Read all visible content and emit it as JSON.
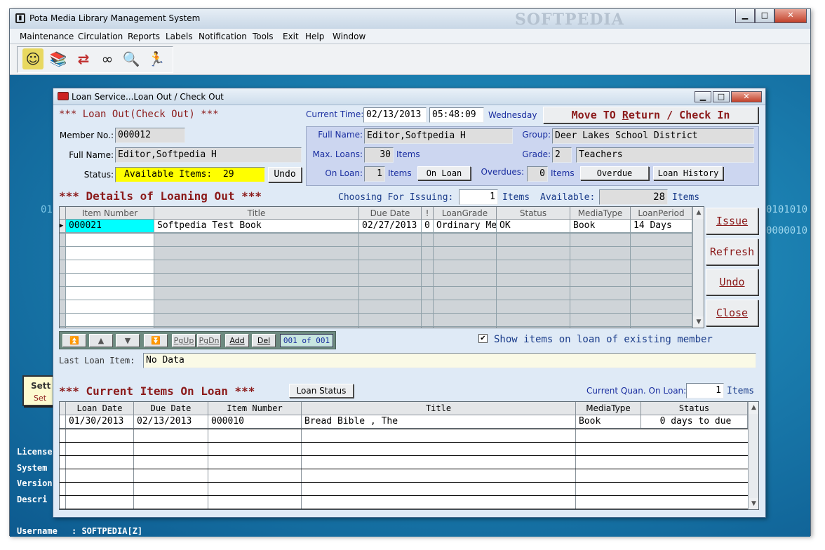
{
  "app": {
    "title": "Pota Media Library Management System",
    "watermark": "SOFTPEDIA",
    "menu": [
      "Maintenance",
      "Circulation",
      "Reports",
      "Labels",
      "Notification",
      "Tools",
      "Exit",
      "Help",
      "Window"
    ],
    "window_controls": {
      "minimize": "▁",
      "maximize": "□",
      "close": "✕"
    }
  },
  "toolbar": {
    "icons": [
      "member-icon",
      "books-icon",
      "circulation-icon",
      "glasses-icon",
      "search-icon",
      "runner-icon"
    ],
    "glyphs": [
      "☺",
      "📚",
      "⇄",
      "∞",
      "🔍",
      "🏃"
    ]
  },
  "desktop": {
    "side_button_top": "Sett",
    "side_button_bottom": "Set",
    "side_labels": [
      "License",
      "System",
      "Version",
      "Descri"
    ],
    "username_label": "Username",
    "username_value": ": SOFTPEDIA[Z]",
    "binary_left": "01",
    "binary_right_1": "0101010",
    "binary_right_2": "0000010"
  },
  "dialog": {
    "title": "Loan Service...Loan Out / Check Out",
    "controls": {
      "minimize": "▁",
      "maximize": "□",
      "close": "✕"
    },
    "header": {
      "heading": "*** Loan Out(Check Out) ***",
      "current_time_label": "Current Time:",
      "date": "02/13/2013",
      "time": "05:48:09",
      "weekday": "Wednesday",
      "mode_button_1": "Move TO ",
      "mode_button_2": "R",
      "mode_button_3": "eturn / Check In"
    },
    "member": {
      "member_no_label": "Member No.:",
      "member_no": "000012",
      "full_name_label": "Full Name:",
      "full_name": "Editor,Softpedia H",
      "status_label": "Status:",
      "status_value": "Available Items:  29",
      "undo_label": "Undo",
      "panel_full_name_label": "Full Name:",
      "panel_full_name": "Editor,Softpedia H",
      "group_label": "Group:",
      "group": "Deer Lakes School District",
      "max_loans_label": "Max. Loans:",
      "max_loans": "30",
      "items_1": "Items",
      "grade_label": "Grade:",
      "grade_code": "2",
      "grade_name": "Teachers",
      "on_loan_label": "On Loan:",
      "on_loan": "1",
      "items_2": "Items",
      "on_loan_button": "On Loan",
      "overdues_label": "Overdues:",
      "overdues": "0",
      "items_3": "Items",
      "overdue_button": "Overdue",
      "loan_history_button": "Loan History"
    },
    "details": {
      "heading": "*** Details of Loaning Out ***",
      "choosing_label": "Choosing For Issuing:",
      "choosing_count": "1",
      "items_a": "Items",
      "available_label": "Available:",
      "available_count": "28",
      "items_b": "Items",
      "columns": [
        "Item Number",
        "Title",
        "Due Date",
        "!",
        "LoanGrade",
        "Status",
        "MediaType",
        "LoanPeriod"
      ],
      "rows": [
        [
          "000021",
          "Softpedia Test Book",
          "02/27/2013",
          "0",
          "Ordinary Me",
          "OK",
          "Book",
          "14 Days"
        ]
      ],
      "row_marker": "▶"
    },
    "actions": {
      "issue": "Issue",
      "refresh": "Refresh",
      "undo": "Undo",
      "close": "Close"
    },
    "navigator": {
      "buttons": [
        "⏫",
        "▲",
        "▼",
        "⏬"
      ],
      "pgup": "PgUp",
      "pgdn": "PgDn",
      "add": "Add",
      "del": "Del",
      "counter": "001 of 001"
    },
    "show_items_checkbox": {
      "label": "Show items on loan of existing member",
      "mark": "✔"
    },
    "last_loan": {
      "label": "Last Loan Item:",
      "value": "No Data"
    },
    "current": {
      "heading": "*** Current Items On Loan ***",
      "loan_status_button": "Loan Status",
      "quan_label": "Current Quan. On Loan:",
      "quan_value": "1",
      "items_label": "Items",
      "columns": [
        "Loan Date",
        "Due Date",
        "Item Number",
        "Title",
        "MediaType",
        "Status"
      ],
      "rows": [
        [
          "01/30/2013",
          "02/13/2013",
          "000010",
          "Bread Bible , The",
          "Book",
          "0 days to due"
        ]
      ]
    }
  }
}
